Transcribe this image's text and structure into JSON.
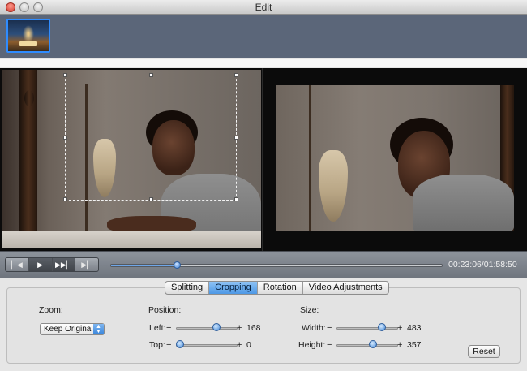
{
  "window": {
    "title": "Edit"
  },
  "player": {
    "timecode": "00:23:06/01:58:50",
    "progress": 0.2,
    "buttons": [
      {
        "name": "previous-frame-button",
        "icon": "skip-back-icon",
        "glyph": "▏◀"
      },
      {
        "name": "play-button",
        "icon": "play-icon",
        "glyph": "▶"
      },
      {
        "name": "fast-forward-button",
        "icon": "fast-forward-icon",
        "glyph": "▶▶▏"
      },
      {
        "name": "next-frame-button",
        "icon": "skip-next-icon",
        "glyph": "▶▏"
      }
    ]
  },
  "tabs": [
    "Splitting",
    "Cropping",
    "Rotation",
    "Video Adjustments"
  ],
  "selected_tab": "Cropping",
  "cropping": {
    "zoom": {
      "label": "Zoom:",
      "value": "Keep Original"
    },
    "position": {
      "label": "Position:",
      "left": {
        "label": "Left:",
        "value": "168",
        "fraction": 0.68
      },
      "top": {
        "label": "Top:",
        "value": "0",
        "fraction": 0.0
      }
    },
    "size": {
      "label": "Size:",
      "width": {
        "label": "Width:",
        "value": "483",
        "fraction": 0.78
      },
      "height": {
        "label": "Height:",
        "value": "357",
        "fraction": 0.6
      }
    },
    "reset_label": "Reset"
  },
  "colors": {
    "accent": "#4d98e6",
    "toolbar": "#5b6679"
  }
}
